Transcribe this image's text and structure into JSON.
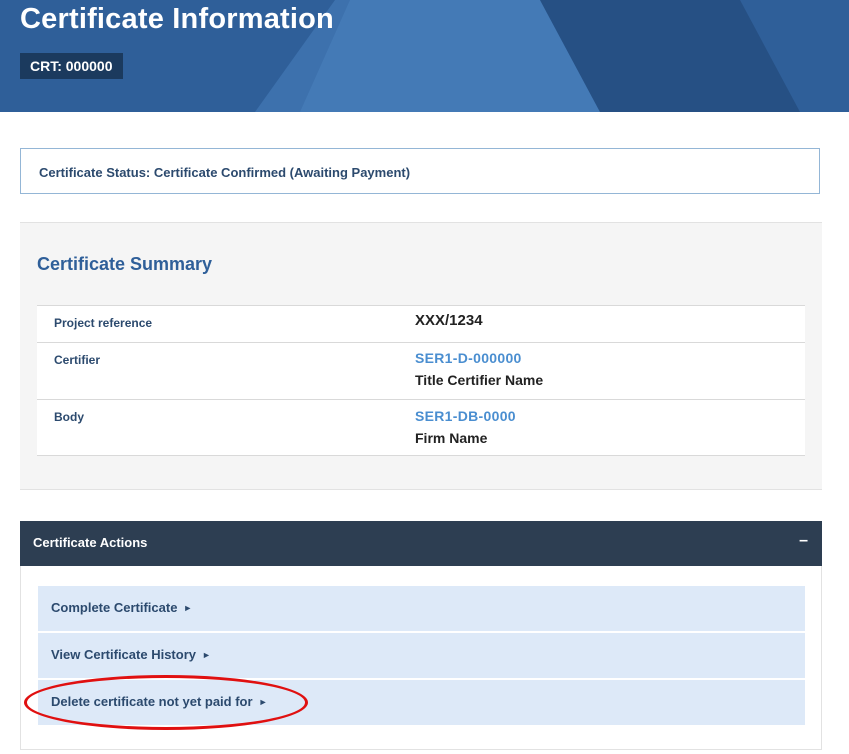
{
  "header": {
    "title": "Certificate Information",
    "crt_badge": "CRT: 000000"
  },
  "status": {
    "text": "Certificate Status: Certificate Confirmed (Awaiting Payment)"
  },
  "summary": {
    "title": "Certificate Summary",
    "rows": [
      {
        "label": "Project reference",
        "value": "XXX/1234"
      },
      {
        "label": "Certifier",
        "link": "SER1-D-000000",
        "value": "Title Certifier Name"
      },
      {
        "label": "Body",
        "link": "SER1-DB-0000",
        "value": "Firm Name"
      }
    ]
  },
  "actions": {
    "title": "Certificate Actions",
    "collapse_symbol": "–",
    "items": [
      {
        "label": "Complete Certificate",
        "arrow": "►"
      },
      {
        "label": "View Certificate History",
        "arrow": "►"
      },
      {
        "label": "Delete certificate not yet paid for",
        "arrow": "►"
      }
    ]
  },
  "colors": {
    "header_bg": "#2f5f99",
    "actions_header_bg": "#2d3e52",
    "action_item_bg": "#dde9f8",
    "link": "#4a8ed0",
    "highlight": "#e01010"
  }
}
